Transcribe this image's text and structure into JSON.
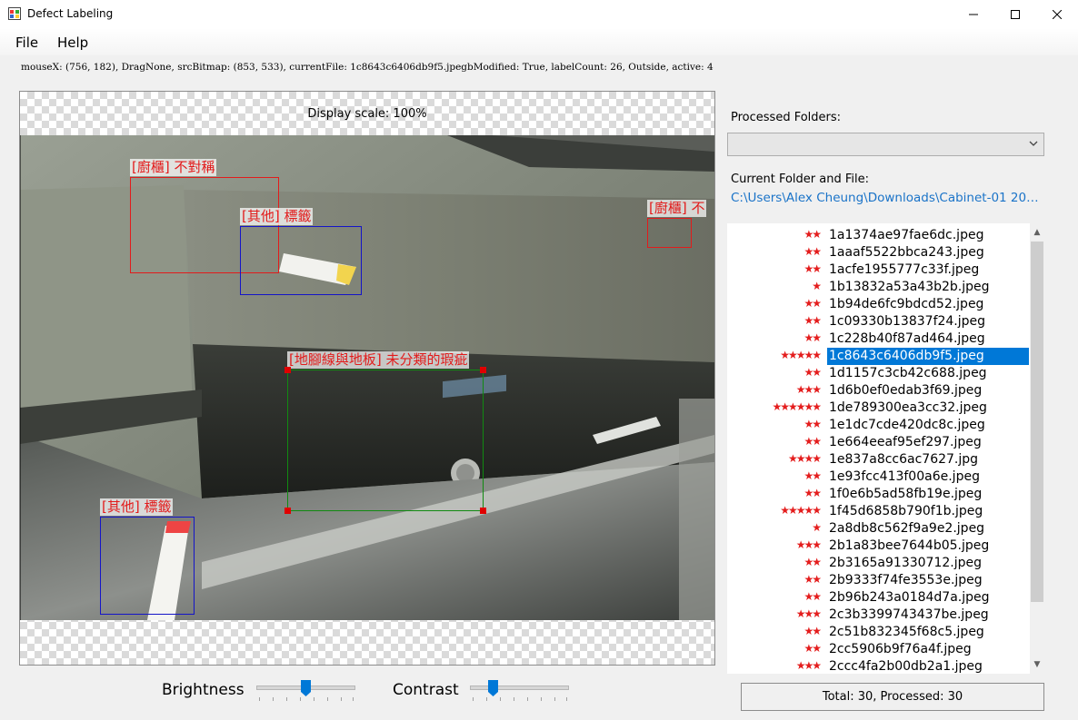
{
  "window": {
    "title": "Defect Labeling"
  },
  "menu": {
    "file": "File",
    "help": "Help"
  },
  "status_line": "mouseX: (756, 182), DragNone, srcBitmap: (853, 533), currentFile: 1c8643c6406db9f5.jpegbModified: True, labelCount: 26, Outside, active: 4",
  "canvas": {
    "display_scale": "Display scale: 100%",
    "annotations": [
      {
        "label": "[廚櫃] 不對稱",
        "color": "#e21b1b"
      },
      {
        "label": "[其他] 標籤",
        "color": "#1414c8"
      },
      {
        "label": "[廚櫃] 不",
        "color": "#e21b1b"
      },
      {
        "label": "[地腳線與地板] 未分類的瑕疵",
        "color": "#118a11"
      },
      {
        "label": "[其他] 標籤",
        "color": "#1414c8"
      }
    ]
  },
  "controls": {
    "brightness_label": "Brightness",
    "contrast_label": "Contrast",
    "brightness_value": 0.5,
    "contrast_value": 0.23
  },
  "right_panel": {
    "processed_folders_label": "Processed Folders:",
    "current_folder_label": "Current Folder and File:",
    "current_path": "C:\\Users\\Alex Cheung\\Downloads\\Cabinet-01 201..."
  },
  "files": [
    {
      "stars": "★★",
      "name": "1a1374ae97fae6dc.jpeg"
    },
    {
      "stars": "★★",
      "name": "1aaaf5522bbca243.jpeg"
    },
    {
      "stars": "★★",
      "name": "1acfe1955777c33f.jpeg"
    },
    {
      "stars": "★",
      "name": "1b13832a53a43b2b.jpeg"
    },
    {
      "stars": "★★",
      "name": "1b94de6fc9bdcd52.jpeg"
    },
    {
      "stars": "★★",
      "name": "1c09330b13837f24.jpeg"
    },
    {
      "stars": "★★",
      "name": "1c228b40f87ad464.jpeg"
    },
    {
      "stars": "★★★★★",
      "name": "1c8643c6406db9f5.jpeg",
      "selected": true
    },
    {
      "stars": "★★",
      "name": "1d1157c3cb42c688.jpeg"
    },
    {
      "stars": "★★★",
      "name": "1d6b0ef0edab3f69.jpeg"
    },
    {
      "stars": "★★★★★★",
      "name": "1de789300ea3cc32.jpeg"
    },
    {
      "stars": "★★",
      "name": "1e1dc7cde420dc8c.jpeg"
    },
    {
      "stars": "★★",
      "name": "1e664eeaf95ef297.jpeg"
    },
    {
      "stars": "★★★★",
      "name": "1e837a8cc6ac7627.jpg"
    },
    {
      "stars": "★★",
      "name": "1e93fcc413f00a6e.jpeg"
    },
    {
      "stars": "★★",
      "name": "1f0e6b5ad58fb19e.jpeg"
    },
    {
      "stars": "★★★★★",
      "name": "1f45d6858b790f1b.jpeg"
    },
    {
      "stars": "★",
      "name": "2a8db8c562f9a9e2.jpeg"
    },
    {
      "stars": "★★★",
      "name": "2b1a83bee7644b05.jpeg"
    },
    {
      "stars": "★★",
      "name": "2b3165a91330712.jpeg"
    },
    {
      "stars": "★★",
      "name": "2b9333f74fe3553e.jpeg"
    },
    {
      "stars": "★★",
      "name": "2b96b243a0184d7a.jpeg"
    },
    {
      "stars": "★★★",
      "name": "2c3b3399743437be.jpeg"
    },
    {
      "stars": "★★",
      "name": "2c51b832345f68c5.jpeg"
    },
    {
      "stars": "★★",
      "name": "2cc5906b9f76a4f.jpeg"
    },
    {
      "stars": "★★★",
      "name": "2ccc4fa2b00db2a1.jpeg"
    }
  ],
  "totals": "Total: 30,   Processed: 30",
  "icons": {
    "app": "app-window-icon",
    "minimize": "minimize-icon",
    "maximize": "maximize-icon",
    "close": "close-icon",
    "dropdown": "chevron-down-icon"
  }
}
